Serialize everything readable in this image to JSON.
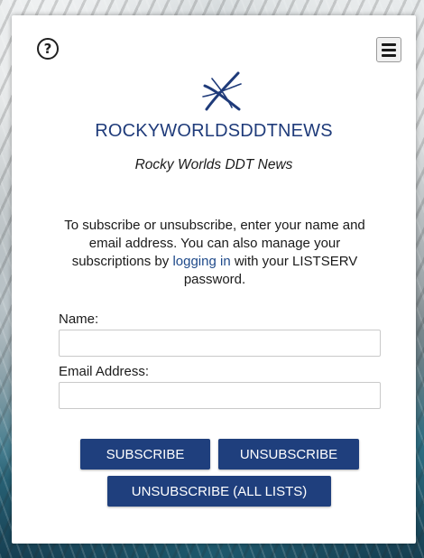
{
  "header": {
    "help_glyph": "?",
    "help_icon": "question-circle-icon",
    "menu_icon": "hamburger-menu-icon"
  },
  "list": {
    "name": "ROCKYWORLDSDDTNEWS",
    "title": "Rocky Worlds DDT News"
  },
  "intro": {
    "text_before_link": "To subscribe or unsubscribe, enter your name and email address. You can also manage your subscriptions by ",
    "link_text": "logging in",
    "text_after_link": " with your LISTSERV password."
  },
  "form": {
    "name_label": "Name:",
    "name_value": "",
    "email_label": "Email Address:",
    "email_value": ""
  },
  "buttons": {
    "subscribe": "SUBSCRIBE",
    "unsubscribe": "UNSUBSCRIBE",
    "unsubscribe_all": "UNSUBSCRIBE (ALL LISTS)"
  },
  "colors": {
    "brand": "#1f3f7d",
    "link": "#1f4a8a",
    "list_name": "#1f3b7a"
  }
}
